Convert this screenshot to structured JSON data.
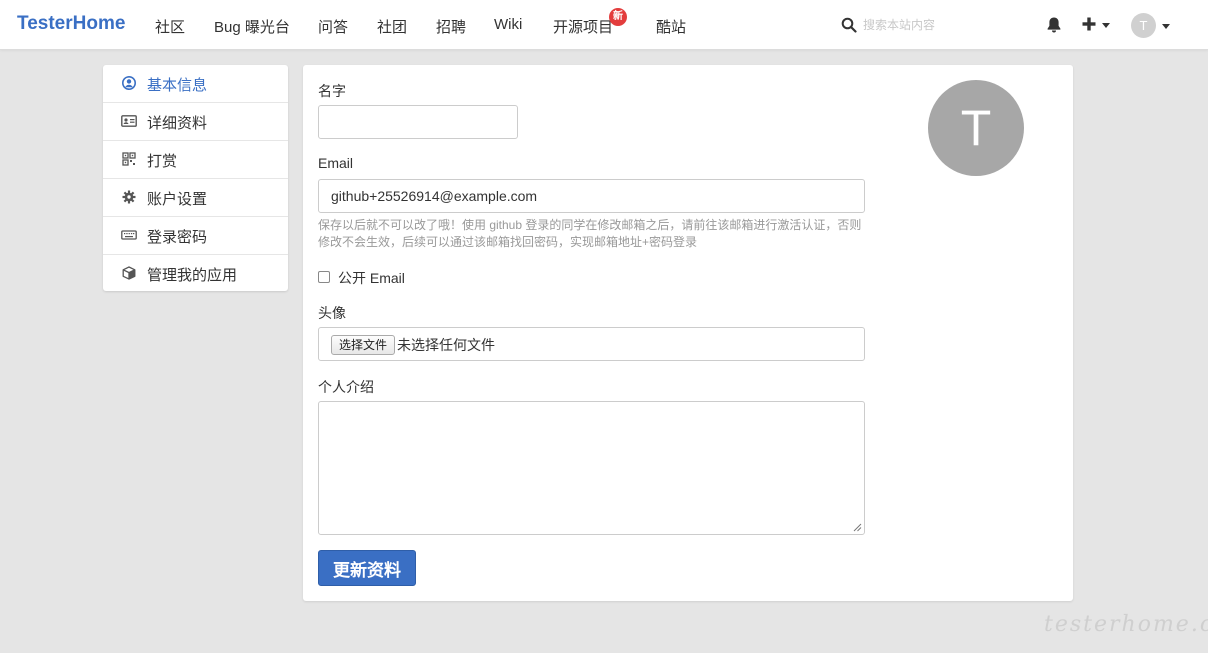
{
  "nav": {
    "brand": "TesterHome",
    "items": [
      "社区",
      "Bug 曝光台",
      "问答",
      "社团",
      "招聘",
      "Wiki",
      "开源项目",
      "酷站"
    ],
    "new_badge": "新",
    "search_placeholder": "搜索本站内容",
    "user_initial": "T"
  },
  "sidebar": {
    "items": [
      {
        "label": "基本信息",
        "icon": "user-circle-icon",
        "active": true
      },
      {
        "label": "详细资料",
        "icon": "id-card-icon",
        "active": false
      },
      {
        "label": "打赏",
        "icon": "qrcode-icon",
        "active": false
      },
      {
        "label": "账户设置",
        "icon": "gear-icon",
        "active": false
      },
      {
        "label": "登录密码",
        "icon": "keyboard-icon",
        "active": false
      },
      {
        "label": "管理我的应用",
        "icon": "cube-icon",
        "active": false
      }
    ]
  },
  "form": {
    "name_label": "名字",
    "name_value": "",
    "email_label": "Email",
    "email_value": "github+25526914@example.com",
    "email_hint": "保存以后就不可以改了哦！使用 github 登录的同学在修改邮箱之后，请前往该邮箱进行激活认证，否则修改不会生效，后续可以通过该邮箱找回密码，实现邮箱地址+密码登录",
    "public_email_label": "公开 Email",
    "public_email_checked": false,
    "avatar_label": "头像",
    "file_button": "选择文件",
    "file_status": "未选择任何文件",
    "bio_label": "个人介绍",
    "bio_value": "",
    "submit_label": "更新资料"
  },
  "avatar": {
    "initial": "T"
  },
  "watermark": "testerhome.com",
  "colors": {
    "accent": "#3a6fc4",
    "badge": "#e33d3d",
    "avatar_bg": "#a7a7a7"
  }
}
